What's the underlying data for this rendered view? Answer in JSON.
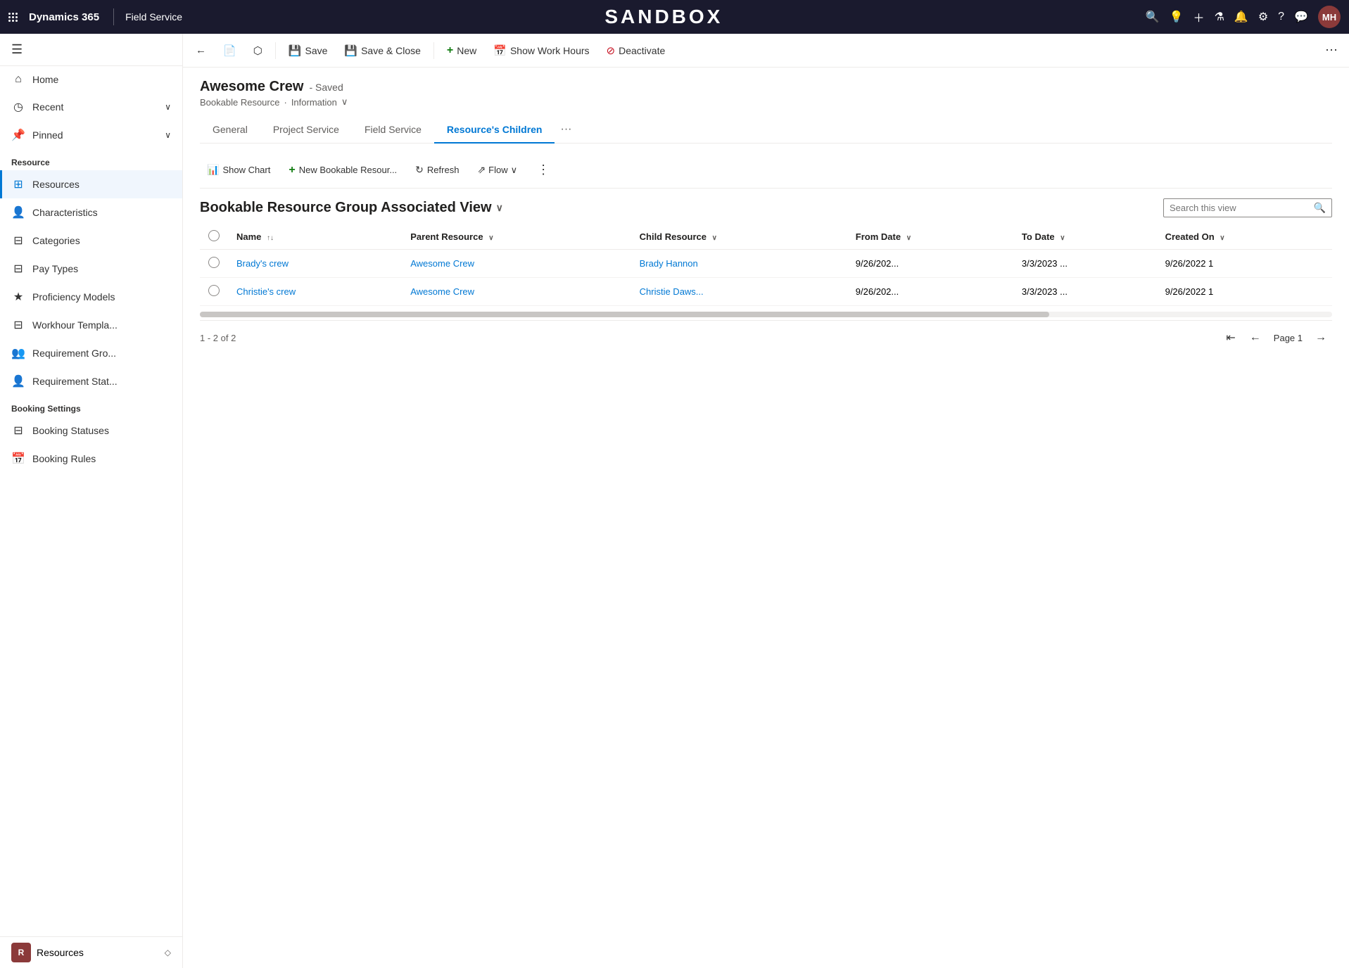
{
  "topbar": {
    "grid_dots": 9,
    "brand": "Dynamics 365",
    "divider": "|",
    "module": "Field Service",
    "sandbox_title": "SANDBOX",
    "avatar_initials": "MH",
    "icons": [
      "search",
      "lightbulb",
      "plus",
      "filter",
      "bell",
      "gear",
      "question",
      "chat"
    ]
  },
  "sidebar": {
    "hamburger": "☰",
    "nav_items": [
      {
        "id": "home",
        "icon": "⌂",
        "label": "Home",
        "has_chevron": false
      },
      {
        "id": "recent",
        "icon": "◷",
        "label": "Recent",
        "has_chevron": true
      },
      {
        "id": "pinned",
        "icon": "📌",
        "label": "Pinned",
        "has_chevron": true
      }
    ],
    "resource_section_label": "Resource",
    "resource_items": [
      {
        "id": "resources",
        "icon": "⊞",
        "label": "Resources",
        "active": true
      },
      {
        "id": "characteristics",
        "icon": "👤",
        "label": "Characteristics",
        "active": false
      },
      {
        "id": "categories",
        "icon": "⊟",
        "label": "Categories",
        "active": false
      },
      {
        "id": "pay-types",
        "icon": "⊟",
        "label": "Pay Types",
        "active": false
      },
      {
        "id": "proficiency-models",
        "icon": "★",
        "label": "Proficiency Models",
        "active": false
      },
      {
        "id": "workhour-templates",
        "icon": "⊟",
        "label": "Workhour Templa...",
        "active": false
      },
      {
        "id": "requirement-groups",
        "icon": "👥",
        "label": "Requirement Gro...",
        "active": false
      },
      {
        "id": "requirement-statuses",
        "icon": "👤",
        "label": "Requirement Stat...",
        "active": false
      }
    ],
    "booking_section_label": "Booking Settings",
    "booking_items": [
      {
        "id": "booking-statuses",
        "icon": "⊟",
        "label": "Booking Statuses",
        "active": false
      },
      {
        "id": "booking-rules",
        "icon": "📅",
        "label": "Booking Rules",
        "active": false
      }
    ],
    "footer": {
      "avatar_initials": "R",
      "label": "Resources"
    }
  },
  "commandbar": {
    "back_icon": "←",
    "record_icon": "📄",
    "open_icon": "⬡",
    "save_label": "Save",
    "save_icon": "💾",
    "save_close_label": "Save & Close",
    "save_close_icon": "💾",
    "new_label": "New",
    "new_icon": "+",
    "show_work_hours_label": "Show Work Hours",
    "show_work_hours_icon": "📅",
    "deactivate_label": "Deactivate",
    "deactivate_icon": "🔴",
    "more_icon": "⋯"
  },
  "form": {
    "title": "Awesome Crew",
    "saved_text": "- Saved",
    "breadcrumb_entity": "Bookable Resource",
    "breadcrumb_dot": "·",
    "breadcrumb_form": "Information",
    "breadcrumb_chevron": "∨"
  },
  "tabs": [
    {
      "id": "general",
      "label": "General",
      "active": false
    },
    {
      "id": "project-service",
      "label": "Project Service",
      "active": false
    },
    {
      "id": "field-service",
      "label": "Field Service",
      "active": false
    },
    {
      "id": "resources-children",
      "label": "Resource's Children",
      "active": true
    }
  ],
  "sub_commandbar": {
    "show_chart_icon": "📊",
    "show_chart_label": "Show Chart",
    "new_icon": "+",
    "new_label": "New Bookable Resour...",
    "refresh_icon": "↻",
    "refresh_label": "Refresh",
    "flow_icon": "⇗",
    "flow_label": "Flow",
    "flow_chevron": "∨",
    "more_icon": "⋮"
  },
  "view": {
    "title": "Bookable Resource Group Associated View",
    "title_chevron": "∨",
    "search_placeholder": "Search this view",
    "search_icon": "🔍"
  },
  "table": {
    "columns": [
      {
        "id": "name",
        "label": "Name",
        "sortable": true,
        "sort_asc": true
      },
      {
        "id": "parent-resource",
        "label": "Parent Resource",
        "sortable": true
      },
      {
        "id": "child-resource",
        "label": "Child Resource",
        "sortable": true
      },
      {
        "id": "from-date",
        "label": "From Date",
        "sortable": true
      },
      {
        "id": "to-date",
        "label": "To Date",
        "sortable": true
      },
      {
        "id": "created-on",
        "label": "Created On",
        "sortable": true
      }
    ],
    "rows": [
      {
        "id": "row1",
        "name": "Brady's crew",
        "parent_resource": "Awesome Crew",
        "child_resource": "Brady Hannon",
        "from_date": "9/26/202...",
        "to_date": "3/3/2023 ...",
        "created_on": "9/26/2022 1"
      },
      {
        "id": "row2",
        "name": "Christie's crew",
        "parent_resource": "Awesome Crew",
        "child_resource": "Christie Daws...",
        "from_date": "9/26/202...",
        "to_date": "3/3/2023 ...",
        "created_on": "9/26/2022 1"
      }
    ]
  },
  "footer": {
    "pagination_info": "1 - 2 of 2",
    "page_label": "Page 1",
    "first_icon": "⇤",
    "prev_icon": "←",
    "next_icon": "→"
  }
}
